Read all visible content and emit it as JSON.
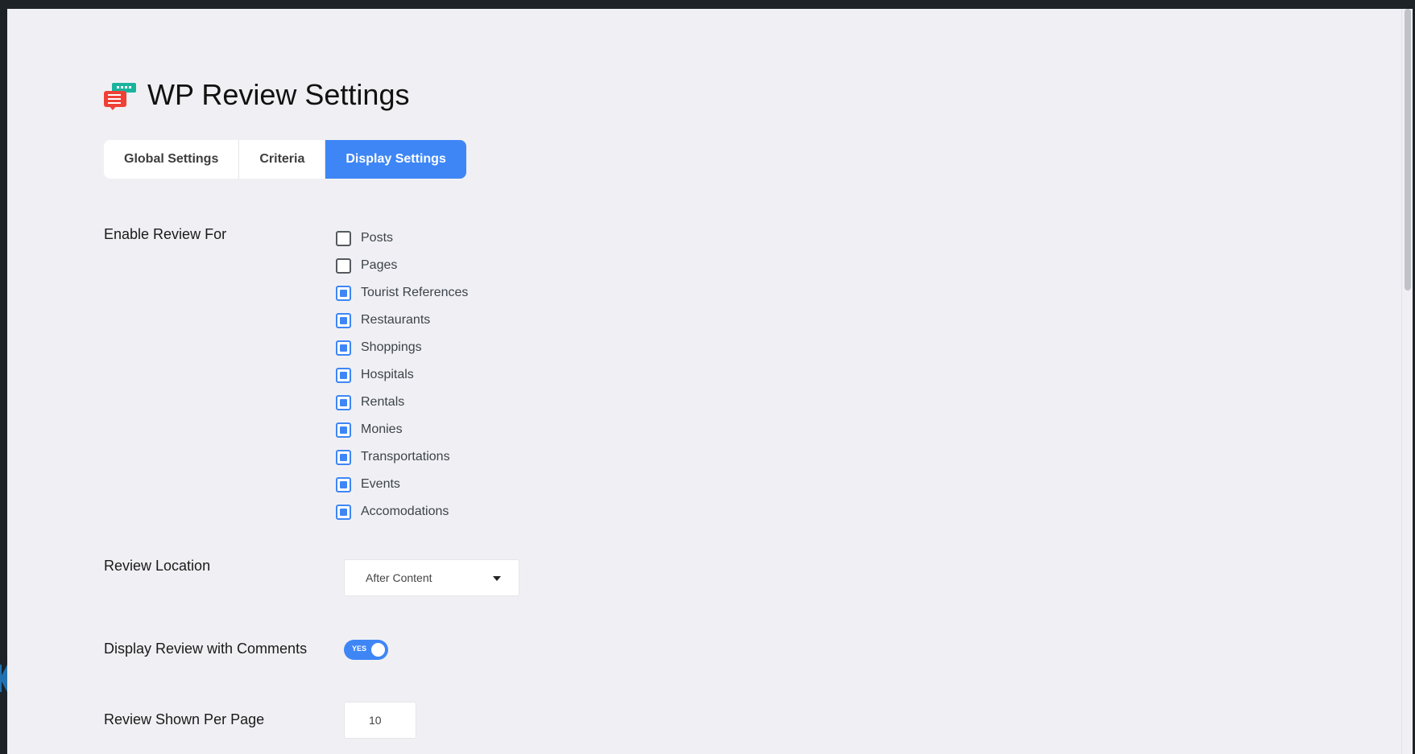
{
  "header": {
    "title": "WP Review Settings",
    "logo_icon": "review-logo-icon"
  },
  "tabs": [
    {
      "label": "Global Settings",
      "active": false
    },
    {
      "label": "Criteria",
      "active": false
    },
    {
      "label": "Display Settings",
      "active": true
    }
  ],
  "enable_review": {
    "label": "Enable Review For",
    "options": [
      {
        "label": "Posts",
        "checked": false
      },
      {
        "label": "Pages",
        "checked": false
      },
      {
        "label": "Tourist References",
        "checked": true
      },
      {
        "label": "Restaurants",
        "checked": true
      },
      {
        "label": "Shoppings",
        "checked": true
      },
      {
        "label": "Hospitals",
        "checked": true
      },
      {
        "label": "Rentals",
        "checked": true
      },
      {
        "label": "Monies",
        "checked": true
      },
      {
        "label": "Transportations",
        "checked": true
      },
      {
        "label": "Events",
        "checked": true
      },
      {
        "label": "Accomodations",
        "checked": true
      }
    ]
  },
  "review_location": {
    "label": "Review Location",
    "value": "After Content"
  },
  "display_with_comments": {
    "label": "Display Review with Comments",
    "toggle_text": "YES",
    "enabled": true
  },
  "per_page": {
    "label": "Review Shown Per Page",
    "value": "10"
  },
  "colors": {
    "accent": "#3e86f5",
    "admin_bar": "#1d2327",
    "background": "#f0f0f4"
  }
}
